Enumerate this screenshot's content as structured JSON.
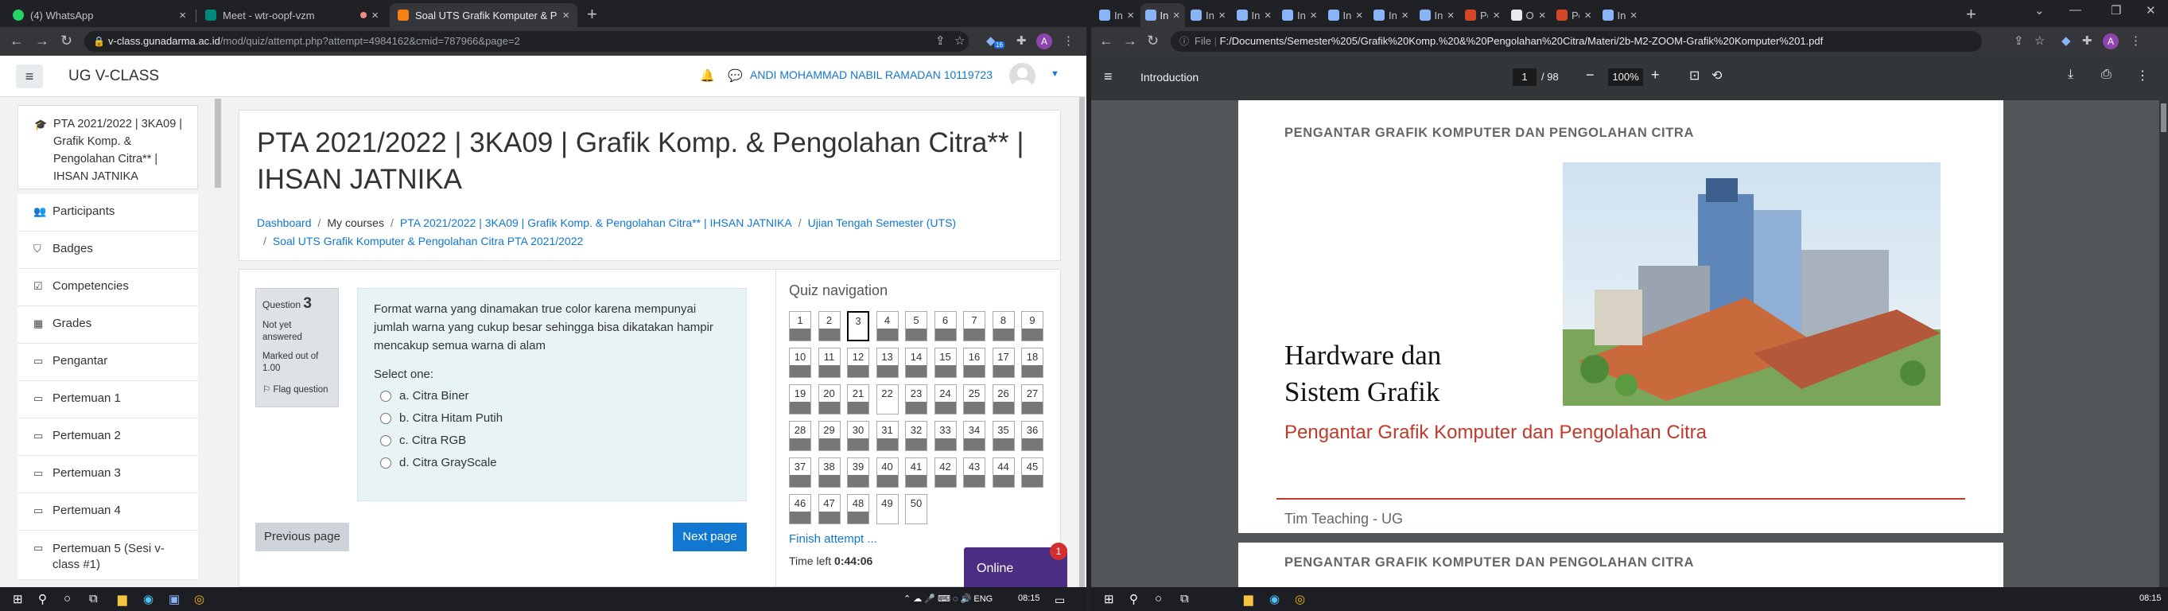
{
  "left_browser": {
    "tabs": [
      {
        "title": "(4) WhatsApp",
        "fav": "#25d366"
      },
      {
        "title": "Meet - wtr-oopf-vzm",
        "fav": "#00897b"
      },
      {
        "title": "Soal UTS Grafik Komputer & Pengolahan Citra",
        "fav": "#f98012"
      }
    ],
    "url_host": "v-class.gunadarma.ac.id",
    "url_path": "/mod/quiz/attempt.php?attempt=4984162&cmid=787966&page=2",
    "ext_badge": "16",
    "profile_initial": "A"
  },
  "moodle": {
    "site_name": "UG V-CLASS",
    "user_name": "ANDI MOHAMMAD NABIL RAMADAN 10119723",
    "course_card": "PTA 2021/2022 | 3KA09 | Grafik Komp. & Pengolahan Citra** | IHSAN JATNIKA",
    "drawer_items": [
      {
        "label": "Participants",
        "icon": "users-icon"
      },
      {
        "label": "Badges",
        "icon": "badge-icon"
      },
      {
        "label": "Competencies",
        "icon": "check-square-icon"
      },
      {
        "label": "Grades",
        "icon": "table-icon"
      },
      {
        "label": "Pengantar",
        "icon": "folder-icon"
      },
      {
        "label": "Pertemuan 1",
        "icon": "folder-icon"
      },
      {
        "label": "Pertemuan 2",
        "icon": "folder-icon"
      },
      {
        "label": "Pertemuan 3",
        "icon": "folder-icon"
      },
      {
        "label": "Pertemuan 4",
        "icon": "folder-icon"
      },
      {
        "label": "Pertemuan 5 (Sesi v-class #1)",
        "icon": "folder-icon"
      }
    ],
    "page_title": "PTA 2021/2022 | 3KA09 | Grafik Komp. & Pengolahan Citra** | IHSAN JATNIKA",
    "breadcrumb": [
      "Dashboard",
      "My courses",
      "PTA 2021/2022 | 3KA09 | Grafik Komp. & Pengolahan Citra** | IHSAN JATNIKA",
      "Ujian Tengah Semester (UTS)",
      "Soal UTS Grafik Komputer & Pengolahan Citra PTA 2021/2022"
    ],
    "question": {
      "label": "Question",
      "number": "3",
      "status": "Not yet answered",
      "marks": "Marked out of 1.00",
      "flag": "Flag question",
      "text": "Format warna yang dinamakan true color karena mempunyai jumlah warna yang cukup besar sehingga bisa dikatakan hampir mencakup semua warna di alam",
      "prompt": "Select one:",
      "options": [
        "a. Citra Biner",
        "b. Citra Hitam Putih",
        "c. Citra RGB",
        "d. Citra GrayScale"
      ]
    },
    "prev_button": "Previous page",
    "next_button": "Next page",
    "quiz_nav": {
      "title": "Quiz navigation",
      "current": 3,
      "answered": [
        1,
        2,
        4,
        5,
        6,
        7,
        8,
        9,
        10,
        11,
        12,
        13,
        14,
        15,
        16,
        17,
        18,
        19,
        20,
        21,
        23,
        24,
        25,
        26,
        27,
        28,
        29,
        30,
        31,
        32,
        33,
        34,
        35,
        36,
        37,
        38,
        39,
        40,
        41,
        42,
        43,
        44,
        45,
        46,
        47,
        48
      ],
      "count": 50,
      "finish": "Finish attempt ...",
      "time_label": "Time left",
      "time_value": "0:44:06"
    },
    "online_label": "Online",
    "online_badge": "1"
  },
  "right_browser": {
    "tabs": [
      "Introd",
      "Introd",
      "Introd",
      "Introd",
      "Introd",
      "Introd",
      "Introd",
      "Introd",
      "Power",
      "Open",
      "Power",
      "Introd"
    ],
    "active_tab": 1,
    "url_prefix": "File",
    "url": "F:/Documents/Semester%205/Grafik%20Komp.%20&%20Pengolahan%20Citra/Materi/2b-M2-ZOOM-Grafik%20Komputer%201.pdf",
    "profile_initial": "A"
  },
  "pdf": {
    "doc_title": "Introduction",
    "page_current": "1",
    "page_total": "/ 98",
    "zoom": "100%",
    "header": "PENGANTAR GRAFIK KOMPUTER DAN PENGOLAHAN CITRA",
    "slide_title_1": "Hardware dan",
    "slide_title_2": "Sistem Grafik",
    "slide_subtitle": "Pengantar Grafik Komputer dan Pengolahan Citra",
    "slide_footer": "Tim Teaching - UG",
    "next_header": "PENGANTAR GRAFIK KOMPUTER DAN PENGOLAHAN CITRA"
  },
  "taskbar": {
    "clock": "08:15"
  }
}
